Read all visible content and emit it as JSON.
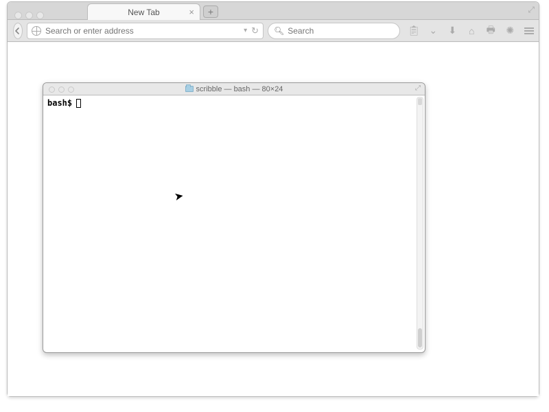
{
  "browser": {
    "tab_title": "New Tab",
    "newtab_plus": "+",
    "urlbar_placeholder": "Search or enter address",
    "searchbar_placeholder": "Search"
  },
  "terminal": {
    "title": "scribble — bash — 80×24",
    "prompt": "bash$"
  }
}
